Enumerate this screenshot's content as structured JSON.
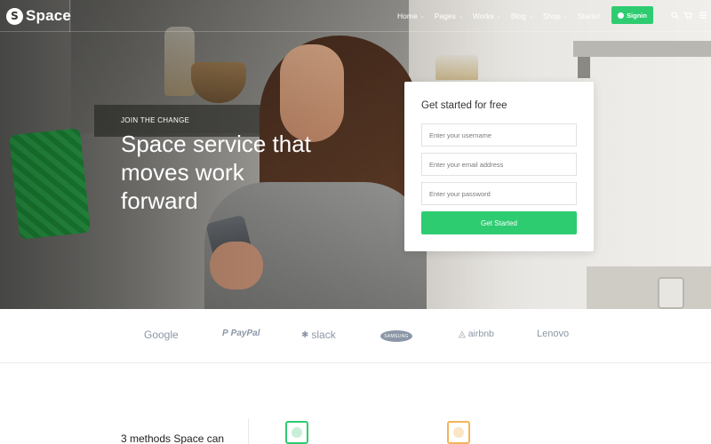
{
  "brand": {
    "mark": "S",
    "name": "Space"
  },
  "nav": {
    "items": [
      {
        "label": "Home",
        "caret": "⌄"
      },
      {
        "label": "Pages",
        "caret": "⌄"
      },
      {
        "label": "Works",
        "caret": "⌄"
      },
      {
        "label": "Blog",
        "caret": "⌄"
      },
      {
        "label": "Shop",
        "caret": "⌄"
      },
      {
        "label": "Starter",
        "caret": ""
      }
    ],
    "signin_label": "Signin",
    "icons": [
      "search-icon",
      "cart-icon",
      "menu-icon"
    ]
  },
  "hero": {
    "eyebrow": "JOIN THE CHANGE",
    "headline": "Space service that moves work forward"
  },
  "signup": {
    "title": "Get started for free",
    "username_placeholder": "Enter your username",
    "email_placeholder": "Enter your email address",
    "password_placeholder": "Enter your password",
    "submit_label": "Get Started"
  },
  "partners": [
    "Google",
    "PayPal",
    "slack",
    "SAMSUNG",
    "airbnb",
    "Lenovo"
  ],
  "section": {
    "heading_partial": "3 methods Space can"
  },
  "colors": {
    "accent": "#2ecc71",
    "partner_logo": "#8b97a6",
    "feature_orange": "#f3b45a"
  }
}
